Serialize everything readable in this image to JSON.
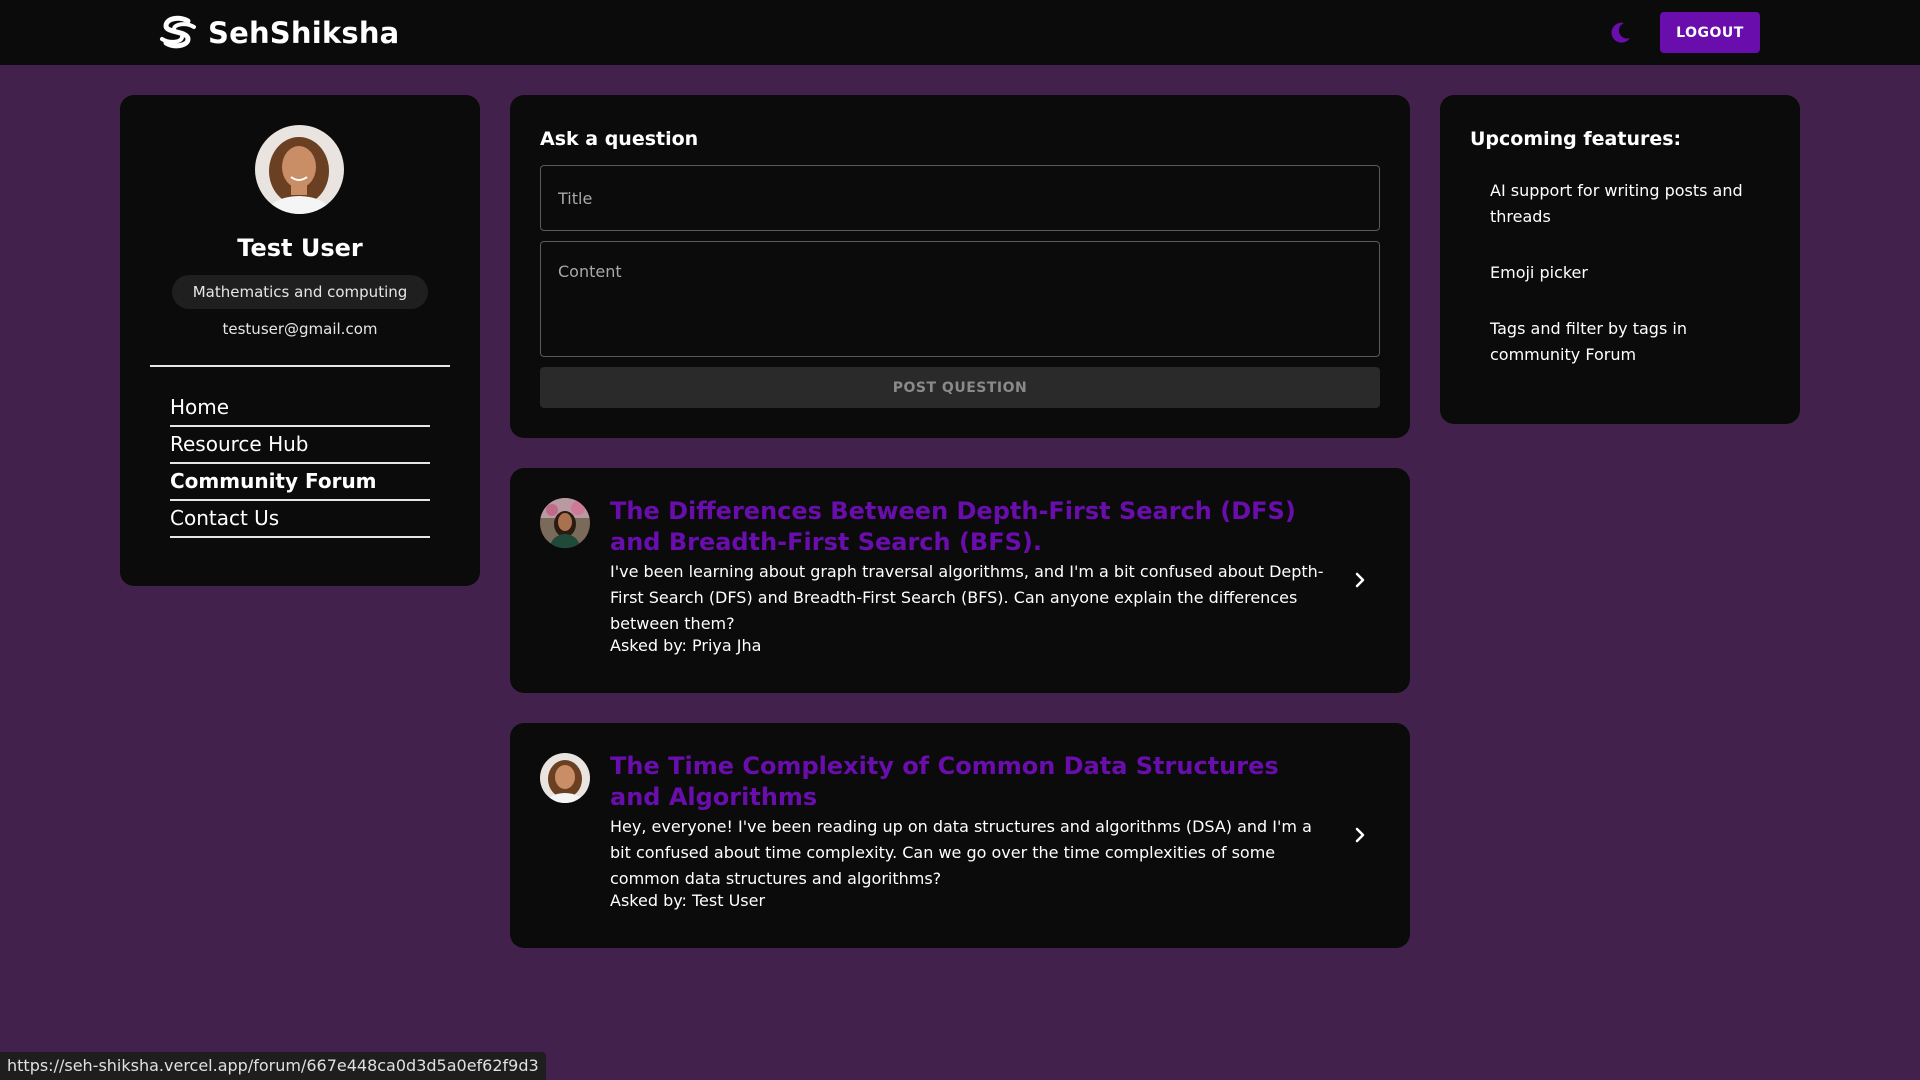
{
  "navbar": {
    "brand_name": "SehShiksha",
    "logout_label": "LOGOUT",
    "theme_icon": "moon-icon",
    "accent_color": "#6a0dad"
  },
  "profile": {
    "name": "Test User",
    "subject": "Mathematics and computing",
    "email": "testuser@gmail.com",
    "nav": [
      {
        "label": "Home",
        "active": false
      },
      {
        "label": "Resource Hub",
        "active": false
      },
      {
        "label": "Community Forum",
        "active": true
      },
      {
        "label": "Contact Us",
        "active": false
      }
    ]
  },
  "ask": {
    "heading": "Ask a question",
    "title_placeholder": "Title",
    "content_placeholder": "Content",
    "post_label": "POST QUESTION"
  },
  "questions": [
    {
      "title": "The Differences Between Depth-First Search (DFS) and Breadth-First Search (BFS).",
      "body": "I've been learning about graph traversal algorithms, and I'm a bit confused about Depth-First Search (DFS) and Breadth-First Search (BFS). Can anyone explain the differences between them?",
      "author": "Asked by: Priya Jha"
    },
    {
      "title": "The Time Complexity of Common Data Structures and Algorithms",
      "body": "Hey, everyone! I've been reading up on data structures and algorithms (DSA) and I'm a bit confused about time complexity. Can we go over the time complexities of some common data structures and algorithms?",
      "author": "Asked by: Test User"
    }
  ],
  "features": {
    "heading": "Upcoming features:",
    "items": [
      "AI support for writing posts and threads",
      "Emoji picker",
      "Tags and filter by tags in community Forum"
    ]
  },
  "status_url": "https://seh-shiksha.vercel.app/forum/667e448ca0d3d5a0ef62f9d3"
}
